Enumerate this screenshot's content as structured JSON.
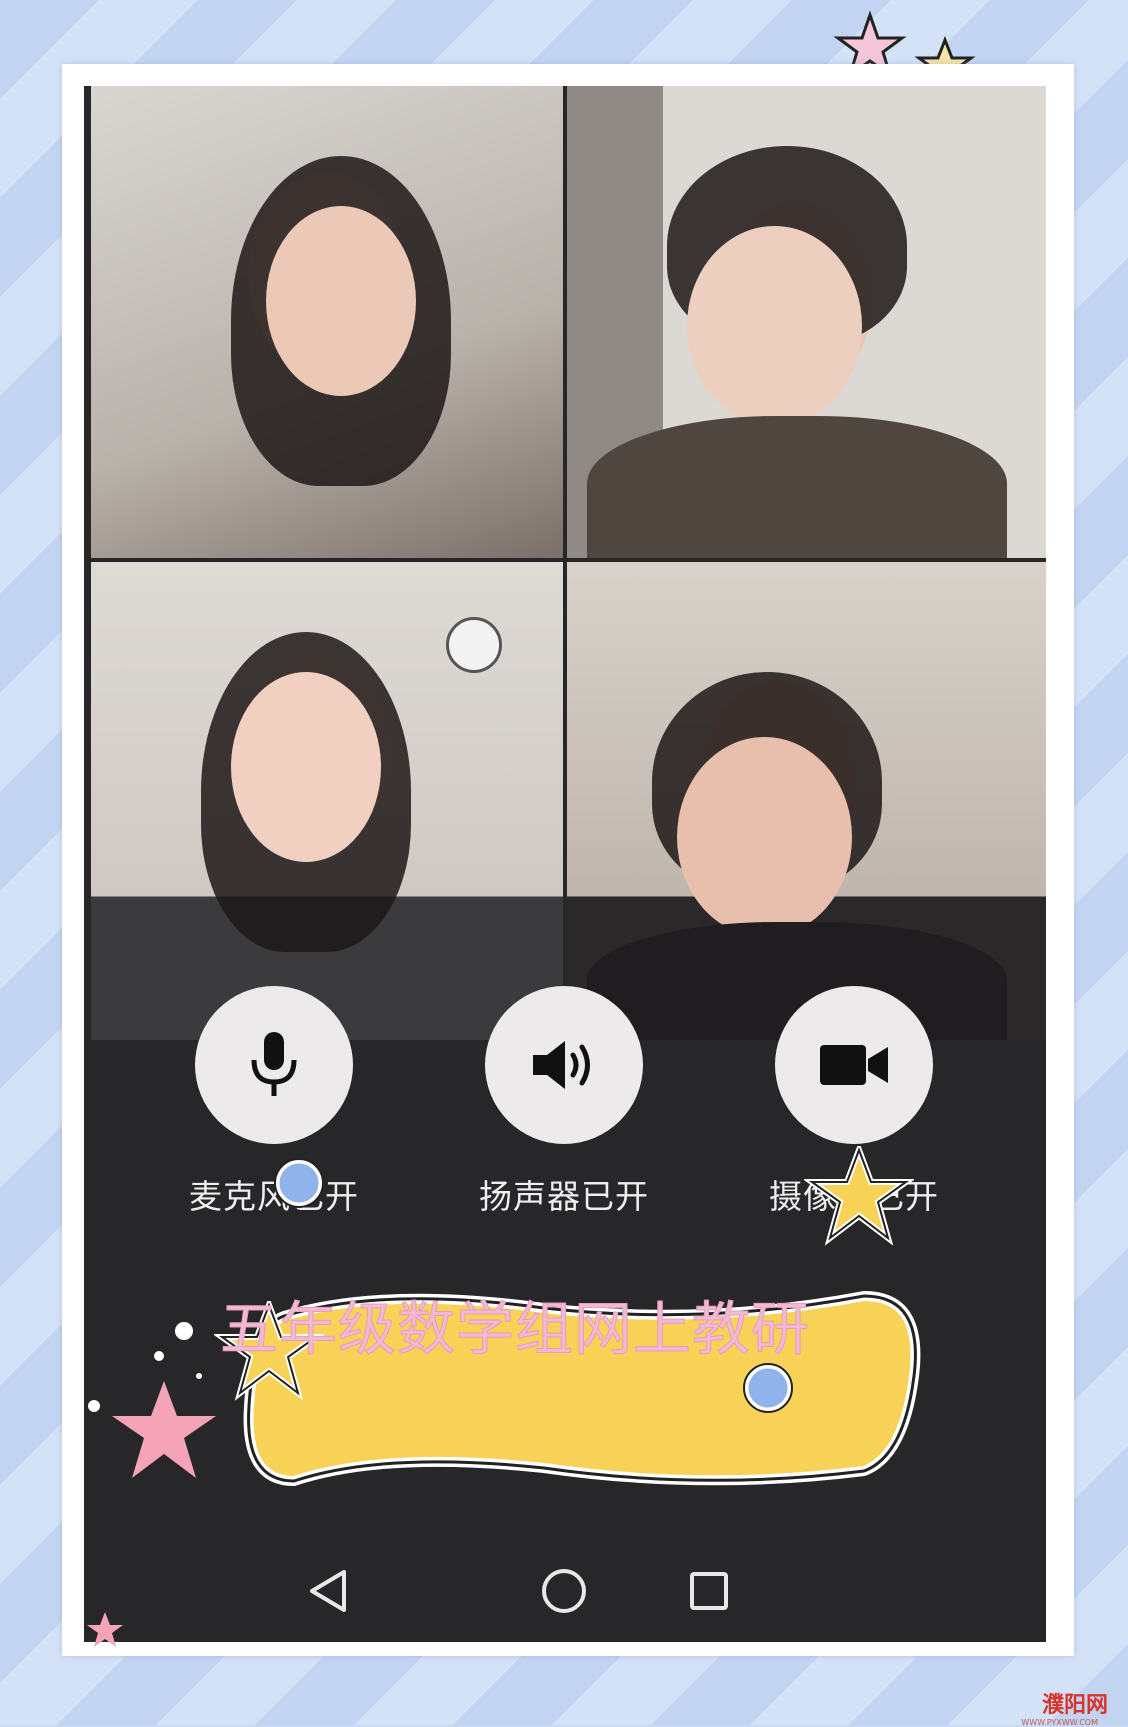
{
  "controls": {
    "microphone": {
      "label": "麦克风已开",
      "icon": "microphone-icon"
    },
    "speaker": {
      "label": "扬声器已开",
      "icon": "speaker-icon"
    },
    "camera": {
      "label": "摄像头已开",
      "icon": "video-camera-icon"
    }
  },
  "banner": {
    "title": "五年级数学组网上教研"
  },
  "navigation": {
    "back_icon": "triangle-back-icon",
    "home_icon": "circle-home-icon",
    "recents_icon": "square-recents-icon"
  },
  "watermark": {
    "text": "濮阳网",
    "sub": "WWW.PYXWW.COM"
  },
  "colors": {
    "screen_bg": "#272629",
    "control_circle": "#eceaea",
    "banner_fill": "#f7d257",
    "banner_text": "#f2b9d2",
    "star_yellow": "#f7d257",
    "dot_blue": "#8fb3ea",
    "star_pink": "#f5a3b7"
  }
}
